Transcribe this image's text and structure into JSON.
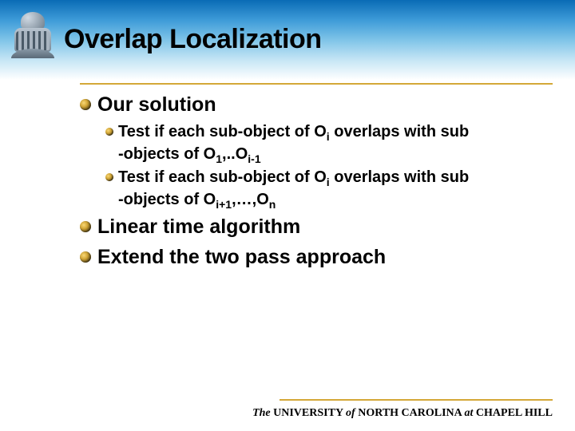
{
  "title": "Overlap Localization",
  "bullets": {
    "l1": {
      "solution": "Our solution",
      "linear": "Linear time algorithm",
      "extend": "Extend the two pass approach"
    },
    "l2": {
      "test1_a": "Test if each sub-object of O",
      "test1_b": " overlaps with sub",
      "test1_c": "-objects of O",
      "test1_d": ",..O",
      "test2_a": "Test if each sub-object of O",
      "test2_b": " overlaps with sub",
      "test2_c": "-objects of O",
      "test2_d": ",…,O",
      "sub_i": "i",
      "sub_1": "1",
      "sub_im1": "i-1",
      "sub_ip1": "i+1",
      "sub_n": "n"
    }
  },
  "footer": {
    "the": "The",
    "univ": " UNIVERSITY ",
    "of": "of",
    "nc": " NORTH  CAROLINA ",
    "at": "at",
    "ch": " CHAPEL HILL"
  }
}
